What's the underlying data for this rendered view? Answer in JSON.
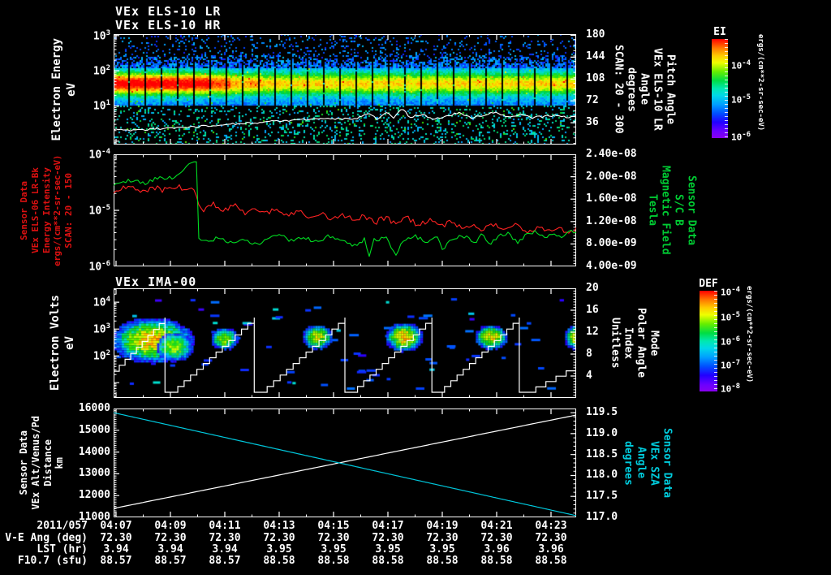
{
  "colors": {
    "background": "#000000",
    "frame": "#ffffff",
    "red_series": "#ff2222",
    "green_series": "#00dd22",
    "cyan_series": "#00c8dd",
    "white_series": "#ffffff",
    "red_label": "#dd1111",
    "green_label": "#00cc33",
    "cyan_label": "#00ccdd"
  },
  "panels": {
    "els": {
      "title1": "VEx ELS-10 LR",
      "title2": "VEx ELS-10 HR",
      "left_label_lines": [
        "Electron Energy",
        "eV"
      ],
      "left_ticks": [
        {
          "v": 1000,
          "t": "10^3"
        },
        {
          "v": 100,
          "t": "10^2"
        },
        {
          "v": 10,
          "t": "10^1"
        }
      ],
      "right_label_lines": [
        "SCAN: 20 - 300",
        "degrees",
        "Angle",
        "VEx ELS-10 LR",
        "Pitch Angle"
      ],
      "right_ticks": [
        {
          "v": 180,
          "t": "180"
        },
        {
          "v": 144,
          "t": "144"
        },
        {
          "v": 108,
          "t": "108"
        },
        {
          "v": 72,
          "t": "72"
        },
        {
          "v": 36,
          "t": "36"
        }
      ]
    },
    "mag": {
      "left_label_lines": [
        "Sensor Data",
        "VEx ELS-06 LR-Bk",
        "Energy Intensity",
        "ergs/(cm**2-sr-sec-eV)",
        "SCAN: 20 - 150"
      ],
      "left_ticks": [
        {
          "v": 0.0001,
          "t": "10^-4"
        },
        {
          "v": 1e-05,
          "t": "10^-5"
        },
        {
          "v": 1e-06,
          "t": "10^-6"
        }
      ],
      "right_label_lines": [
        "Tesla",
        "Magnetic Field",
        "S/C B",
        "Sensor Data"
      ],
      "right_ticks": [
        {
          "v": 2.4e-08,
          "t": "2.40e-08"
        },
        {
          "v": 2e-08,
          "t": "2.00e-08"
        },
        {
          "v": 1.6e-08,
          "t": "1.60e-08"
        },
        {
          "v": 1.2e-08,
          "t": "1.20e-08"
        },
        {
          "v": 8e-09,
          "t": "8.00e-09"
        },
        {
          "v": 4e-09,
          "t": "4.00e-09"
        }
      ]
    },
    "ima": {
      "title": "VEx IMA-00",
      "left_label_lines": [
        "Electron Volts",
        "eV"
      ],
      "left_ticks": [
        {
          "v": 10000,
          "t": "10^4"
        },
        {
          "v": 1000,
          "t": "10^3"
        },
        {
          "v": 100,
          "t": "10^2"
        }
      ],
      "right_label_lines": [
        "Unitless",
        "Index",
        "Polar Angle",
        "Mode"
      ],
      "right_ticks": [
        {
          "v": 20,
          "t": "20"
        },
        {
          "v": 16,
          "t": "16"
        },
        {
          "v": 12,
          "t": "12"
        },
        {
          "v": 8,
          "t": "8"
        },
        {
          "v": 4,
          "t": "4"
        }
      ]
    },
    "orb": {
      "left_label_lines": [
        "Sensor Data",
        "VEx Alt/Venus/Pd",
        "Distance",
        "km"
      ],
      "left_ticks": [
        {
          "v": 16000,
          "t": "16000"
        },
        {
          "v": 15000,
          "t": "15000"
        },
        {
          "v": 14000,
          "t": "14000"
        },
        {
          "v": 13000,
          "t": "13000"
        },
        {
          "v": 12000,
          "t": "12000"
        },
        {
          "v": 11000,
          "t": "11000"
        }
      ],
      "right_label_lines": [
        "degrees",
        "Angle",
        "VEx SZA",
        "Sensor Data"
      ],
      "right_ticks": [
        {
          "v": 119.5,
          "t": "119.5"
        },
        {
          "v": 119.0,
          "t": "119.0"
        },
        {
          "v": 118.5,
          "t": "118.5"
        },
        {
          "v": 118.0,
          "t": "118.0"
        },
        {
          "v": 117.5,
          "t": "117.5"
        },
        {
          "v": 117.0,
          "t": "117.0"
        }
      ]
    }
  },
  "colorbars": [
    {
      "id": "ei",
      "title": "EI",
      "unit": "ergs/(cm**2-sr-sec-eV)",
      "labels": [
        {
          "t": "10^-4",
          "f": 0.26
        },
        {
          "t": "10^-5",
          "f": 0.61
        },
        {
          "t": "10^-6",
          "f": 0.98
        }
      ]
    },
    {
      "id": "def",
      "title": "DEF",
      "unit": "ergs/(cm**2-sr-sec-eV)",
      "labels": [
        {
          "t": "10^-4",
          "f": 0.01
        },
        {
          "t": "10^-5",
          "f": 0.255
        },
        {
          "t": "10^-6",
          "f": 0.5
        },
        {
          "t": "10^-7",
          "f": 0.735
        },
        {
          "t": "10^-8",
          "f": 0.97
        }
      ]
    }
  ],
  "bottom": {
    "date": "2011/057",
    "times": [
      "04:07",
      "04:09",
      "04:11",
      "04:13",
      "04:15",
      "04:17",
      "04:19",
      "04:21",
      "04:23"
    ],
    "rows": [
      {
        "label": "V-E Ang (deg)",
        "values": [
          "72.30",
          "72.30",
          "72.30",
          "72.30",
          "72.30",
          "72.30",
          "72.30",
          "72.30",
          "72.30"
        ]
      },
      {
        "label": "LST (hr)",
        "values": [
          "3.94",
          "3.94",
          "3.94",
          "3.95",
          "3.95",
          "3.95",
          "3.95",
          "3.96",
          "3.96"
        ]
      },
      {
        "label": "F10.7 (sfu)",
        "values": [
          "88.57",
          "88.57",
          "88.57",
          "88.58",
          "88.58",
          "88.58",
          "88.58",
          "88.58",
          "88.58"
        ]
      }
    ]
  },
  "chart_data": [
    {
      "id": "els",
      "type": "heatmap",
      "title": "VEx ELS-10 LR / VEx ELS-10 HR",
      "ylabel": "Electron Energy eV",
      "yscale": "log",
      "ylim": [
        0.8,
        1100
      ],
      "yticks": [
        "10^3",
        "10^2",
        "10^1"
      ],
      "right_axis": {
        "label": "Pitch Angle VEx ELS-10 LR Angle degrees SCAN: 20 - 300",
        "lim": [
          0,
          182
        ],
        "ticks": [
          180,
          144,
          108,
          72,
          36
        ]
      },
      "colorbar": "EI  ergs/(cm**2-sr-sec-eV)  10^-4..10^-6",
      "xaxis": {
        "start": "04:07",
        "end": "04:23",
        "tick_every_min": 2
      },
      "band": {
        "core_ev": 45,
        "solid_lo_ev": 11,
        "solid_hi_ev": 126,
        "cap_hi_ev": 316,
        "hot_until_frac": 0.22
      },
      "overlay_line": {
        "name": "low-energy trace",
        "units": "eV",
        "points": [
          [
            0,
            2.1
          ],
          [
            0.05,
            2.0
          ],
          [
            0.105,
            2.3
          ],
          [
            0.158,
            2.4
          ],
          [
            0.21,
            2.8
          ],
          [
            0.263,
            3.1
          ],
          [
            0.316,
            3.4
          ],
          [
            0.368,
            3.8
          ],
          [
            0.42,
            4.2
          ],
          [
            0.474,
            4.2
          ],
          [
            0.526,
            4.4
          ],
          [
            0.553,
            6.1
          ],
          [
            0.57,
            4.2
          ],
          [
            0.588,
            6.8
          ],
          [
            0.605,
            4.6
          ],
          [
            0.623,
            8.2
          ],
          [
            0.64,
            4.8
          ],
          [
            0.667,
            5.7
          ],
          [
            0.693,
            4.2
          ],
          [
            0.719,
            5.1
          ],
          [
            0.746,
            6.4
          ],
          [
            0.772,
            4.6
          ],
          [
            0.798,
            5.3
          ],
          [
            0.825,
            6.8
          ],
          [
            0.851,
            4.8
          ],
          [
            0.877,
            5.7
          ],
          [
            0.904,
            4.6
          ],
          [
            0.93,
            5.1
          ],
          [
            0.956,
            5.3
          ],
          [
            0.982,
            4.8
          ],
          [
            1,
            5.1
          ]
        ]
      }
    },
    {
      "id": "mag",
      "type": "line",
      "left_axis": {
        "label": "Sensor Data VEx ELS-06 LR-Bk Energy Intensity ergs/(cm**2-sr-sec-eV) SCAN: 20 - 150",
        "scale": "log",
        "lim": [
          1e-06,
          0.0001
        ]
      },
      "right_axis": {
        "label": "Sensor Data S/C B Magnetic Field Tesla",
        "lim": [
          4e-09,
          2.4e-08
        ]
      },
      "series": [
        {
          "name": "Energy Intensity VEx ELS-06 LR-Bk",
          "color_key": "red_series",
          "units": "log10 ergs/(cm**2-sr-sec-eV)",
          "noise": 3.5,
          "points": [
            [
              0,
              -4.65
            ],
            [
              0.032,
              -4.58
            ],
            [
              0.061,
              -4.67
            ],
            [
              0.088,
              -4.59
            ],
            [
              0.114,
              -4.65
            ],
            [
              0.14,
              -4.58
            ],
            [
              0.158,
              -4.67
            ],
            [
              0.175,
              -4.61
            ],
            [
              0.182,
              -4.84
            ],
            [
              0.196,
              -4.99
            ],
            [
              0.214,
              -4.88
            ],
            [
              0.237,
              -5.01
            ],
            [
              0.26,
              -4.91
            ],
            [
              0.284,
              -5.04
            ],
            [
              0.307,
              -4.94
            ],
            [
              0.33,
              -5.07
            ],
            [
              0.354,
              -4.97
            ],
            [
              0.377,
              -5.1
            ],
            [
              0.4,
              -5.0
            ],
            [
              0.425,
              -5.13
            ],
            [
              0.447,
              -5.03
            ],
            [
              0.47,
              -5.16
            ],
            [
              0.495,
              -5.06
            ],
            [
              0.518,
              -5.19
            ],
            [
              0.54,
              -5.09
            ],
            [
              0.565,
              -5.22
            ],
            [
              0.588,
              -5.12
            ],
            [
              0.611,
              -5.25
            ],
            [
              0.635,
              -5.14
            ],
            [
              0.658,
              -5.26
            ],
            [
              0.681,
              -5.17
            ],
            [
              0.705,
              -5.29
            ],
            [
              0.728,
              -5.2
            ],
            [
              0.751,
              -5.32
            ],
            [
              0.775,
              -5.23
            ],
            [
              0.798,
              -5.35
            ],
            [
              0.821,
              -5.26
            ],
            [
              0.846,
              -5.36
            ],
            [
              0.868,
              -5.28
            ],
            [
              0.891,
              -5.38
            ],
            [
              0.916,
              -5.29
            ],
            [
              0.939,
              -5.39
            ],
            [
              0.961,
              -5.3
            ],
            [
              0.982,
              -5.39
            ],
            [
              1,
              -5.33
            ]
          ]
        },
        {
          "name": "Magnetic Field S/C B",
          "color_key": "green_series",
          "units": "1e-9 Tesla",
          "noise": 2.5,
          "points": [
            [
              0,
              18.8
            ],
            [
              0.035,
              19.4
            ],
            [
              0.07,
              18.9
            ],
            [
              0.096,
              19.9
            ],
            [
              0.123,
              19.7
            ],
            [
              0.149,
              21.1
            ],
            [
              0.167,
              22.3
            ],
            [
              0.175,
              23.0
            ],
            [
              0.181,
              22.7
            ],
            [
              0.184,
              8.9
            ],
            [
              0.202,
              8.3
            ],
            [
              0.228,
              9.2
            ],
            [
              0.254,
              8.2
            ],
            [
              0.281,
              8.9
            ],
            [
              0.307,
              7.9
            ],
            [
              0.333,
              8.9
            ],
            [
              0.36,
              9.7
            ],
            [
              0.386,
              8.5
            ],
            [
              0.412,
              9.2
            ],
            [
              0.439,
              8.3
            ],
            [
              0.465,
              9.5
            ],
            [
              0.491,
              8.8
            ],
            [
              0.518,
              7.6
            ],
            [
              0.544,
              8.9
            ],
            [
              0.551,
              5.3
            ],
            [
              0.561,
              8.6
            ],
            [
              0.588,
              9.2
            ],
            [
              0.611,
              6.0
            ],
            [
              0.623,
              8.6
            ],
            [
              0.649,
              9.5
            ],
            [
              0.675,
              8.3
            ],
            [
              0.702,
              9.1
            ],
            [
              0.712,
              6.5
            ],
            [
              0.728,
              8.8
            ],
            [
              0.754,
              9.5
            ],
            [
              0.781,
              8.3
            ],
            [
              0.798,
              9.9
            ],
            [
              0.811,
              7.8
            ],
            [
              0.828,
              9.2
            ],
            [
              0.854,
              9.9
            ],
            [
              0.872,
              8.2
            ],
            [
              0.889,
              9.5
            ],
            [
              0.912,
              10.2
            ],
            [
              0.933,
              9.1
            ],
            [
              0.953,
              9.9
            ],
            [
              0.97,
              9.2
            ],
            [
              0.986,
              10.5
            ],
            [
              1,
              10.2
            ]
          ]
        }
      ]
    },
    {
      "id": "ima",
      "type": "heatmap",
      "title": "VEx IMA-00",
      "ylabel": "Electron Volts eV",
      "yscale": "log",
      "ylim": [
        2.7,
        33000
      ],
      "yticks": [
        "10^4",
        "10^3",
        "10^2"
      ],
      "right_axis": {
        "label": "Mode Polar Angle Index Unitless",
        "lim": [
          0,
          20
        ],
        "ticks": [
          20,
          16,
          12,
          8,
          4
        ]
      },
      "colorbar": "DEF  ergs/(cm**2-sr-sec-eV)  10^-4..10^-8",
      "blobs": [
        {
          "fx": 0.084,
          "fy": 0.474,
          "frx": 0.07,
          "fry": 0.163,
          "heat": 0.95
        },
        {
          "fx": 0.132,
          "fy": 0.533,
          "frx": 0.032,
          "fry": 0.104,
          "heat": 0.8
        },
        {
          "fx": 0.239,
          "fy": 0.459,
          "frx": 0.023,
          "fry": 0.081,
          "heat": 0.8
        },
        {
          "fx": 0.44,
          "fy": 0.444,
          "frx": 0.026,
          "fry": 0.089,
          "heat": 0.85
        },
        {
          "fx": 0.628,
          "fy": 0.444,
          "frx": 0.032,
          "fry": 0.104,
          "heat": 0.95
        },
        {
          "fx": 0.816,
          "fy": 0.444,
          "frx": 0.028,
          "fry": 0.089,
          "heat": 0.9
        },
        {
          "fx": 1.0,
          "fy": 0.444,
          "frx": 0.021,
          "fry": 0.089,
          "heat": 0.85
        }
      ],
      "sawtooth": {
        "name": "polar angle index sweep",
        "y_bottom": 0.948,
        "ramps": [
          [
            0,
            0.756,
            0.111,
            0.267
          ],
          [
            0.125,
            0.948,
            0.304,
            0.267
          ],
          [
            0.318,
            0.948,
            0.5,
            0.267
          ],
          [
            0.514,
            0.948,
            0.688,
            0.267
          ],
          [
            0.702,
            0.948,
            0.877,
            0.267
          ],
          [
            0.891,
            0.948,
            1.0,
            0.704
          ]
        ]
      }
    },
    {
      "id": "orb",
      "type": "line",
      "left_axis": {
        "label": "Sensor Data VEx Alt/Venus/Pd Distance km",
        "lim": [
          11000,
          16000
        ]
      },
      "right_axis": {
        "label": "Sensor Data VEx SZA Angle degrees",
        "lim": [
          117.0,
          119.6
        ]
      },
      "series": [
        {
          "name": "VEx Alt/Venus/Pd Distance",
          "color_key": "white_series",
          "units": "km",
          "noise": 0,
          "points": [
            [
              0,
              11410
            ],
            [
              1,
              15700
            ]
          ]
        },
        {
          "name": "VEx SZA",
          "color_key": "cyan_series",
          "units": "degrees",
          "noise": 0,
          "points": [
            [
              0,
              119.5
            ],
            [
              1,
              117.04
            ]
          ]
        }
      ]
    }
  ]
}
